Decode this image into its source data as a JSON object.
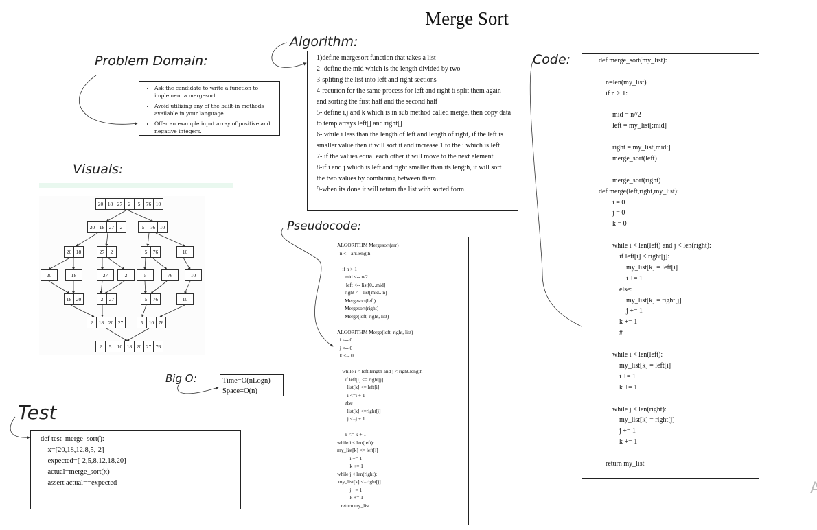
{
  "title": "Merge Sort",
  "labels": {
    "problem_domain": "Problem Domain:",
    "algorithm": "Algorithm:",
    "code": "Code:",
    "visuals": "Visuals:",
    "pseudocode": "Pseudocode:",
    "big_o": "Big O:",
    "test": "Test"
  },
  "problem_domain": {
    "bullets": [
      "Ask the candidate to write a function to implement a mergesort.",
      "Avoid utilizing any of the built-in methods available in your language.",
      "Offer an example input array of positive and negative integers."
    ]
  },
  "algorithm": {
    "lines": [
      "1)define mergesort function that takes a list",
      "2- define the mid which is the length divided by two",
      "3-spliting the list into left and right sections",
      "4-recurion for the same process for left and right ti split them again and sorting the first half and the second half",
      "5- define i,j and k which is in sub method called merge, then copy data to temp arrays left[] and right[]",
      "6- while i less than the length of left and length of right, if the left is smaller value then it will sort it and increase 1 to the i which is left",
      "7- if the values equal each other it will move to the next element",
      "8-if i and j which is left and right smaller than its length, it will sort the two values by combining between them",
      "9-when its done it will return the list with sorted form"
    ]
  },
  "code": {
    "lines": [
      "def merge_sort(my_list):",
      "",
      "    n=len(my_list)",
      "    if n > 1:",
      "",
      "        mid = n//2",
      "        left = my_list[:mid]",
      "",
      "        right = my_list[mid:]",
      "        merge_sort(left)",
      "",
      "        merge_sort(right)",
      "def merge(left,right,my_list):",
      "        i = 0",
      "        j = 0",
      "        k = 0",
      "",
      "        while i < len(left) and j < len(right):",
      "            if left[i] < right[j]:",
      "                my_list[k] = left[i]",
      "                i += 1",
      "            else:",
      "                my_list[k] = right[j]",
      "                j += 1",
      "            k += 1",
      "            #",
      "",
      "        while i < len(left):",
      "            my_list[k] = left[i]",
      "            i += 1",
      "            k += 1",
      "",
      "        while j < len(right):",
      "            my_list[k] = right[j]",
      "            j += 1",
      "            k += 1",
      "",
      "    return my_list"
    ]
  },
  "pseudocode": {
    "lines": [
      "ALGORITHM Mergesort(arr)",
      "  n <-- arr.length",
      "",
      "    if n > 1",
      "      mid <-- n/2",
      "       left <-- list[0...mid]",
      "      right <-- list[mid...n]",
      "      Mergesort(left)",
      "      Mergesort(right)",
      "      Merge(left, right, list)",
      "",
      "ALGORITHM Merge(left, right, list)",
      "  i <-- 0",
      "  j <-- 0",
      "  k <-- 0",
      "",
      "    while i < left.length and j < right.length",
      "      if left[i] <= right[j]",
      "        list[k] <= left[i]",
      "        i <=i + 1",
      "      else",
      "        list[k] <=right[j]",
      "        j <=j + 1",
      "",
      "      k <= k + 1",
      "while i < len(left):",
      "my_list[k] <= left[i]",
      "          i += 1",
      "          k += 1",
      "while j < len(right):",
      " my_list[k] <=right[j]",
      "          j += 1",
      "          k += 1",
      "   return my_list"
    ]
  },
  "big_o": {
    "time": "Time=O(nLogn)",
    "space": "Space=O(n)"
  },
  "test": {
    "lines": [
      "def test_merge_sort():",
      "    x=[20,18,12,8,5,-2]",
      "    expected=[-2,5,8,12,18,20]",
      "    actual=merge_sort(x)",
      "    assert actual==expected"
    ]
  },
  "visual_tree": {
    "level0": [
      "20",
      "18",
      "27",
      "2",
      "5",
      "76",
      "10"
    ],
    "level1_left": [
      "20",
      "18",
      "27",
      "2"
    ],
    "level1_right": [
      "5",
      "76",
      "10"
    ],
    "level2_a": [
      "20",
      "18"
    ],
    "level2_b": [
      "27",
      "2"
    ],
    "level2_c": [
      "5",
      "76"
    ],
    "level2_d": [
      "10"
    ],
    "level3": [
      "20",
      "18",
      "27",
      "2",
      "5",
      "76",
      "10"
    ],
    "level4_a": [
      "18",
      "20"
    ],
    "level4_b": [
      "2",
      "27"
    ],
    "level4_c": [
      "5",
      "76"
    ],
    "level4_d": [
      "10"
    ],
    "level5_left": [
      "2",
      "18",
      "20",
      "27"
    ],
    "level5_right": [
      "5",
      "10",
      "76"
    ],
    "level6": [
      "2",
      "5",
      "10",
      "18",
      "20",
      "27",
      "76"
    ]
  },
  "watermark": "A"
}
